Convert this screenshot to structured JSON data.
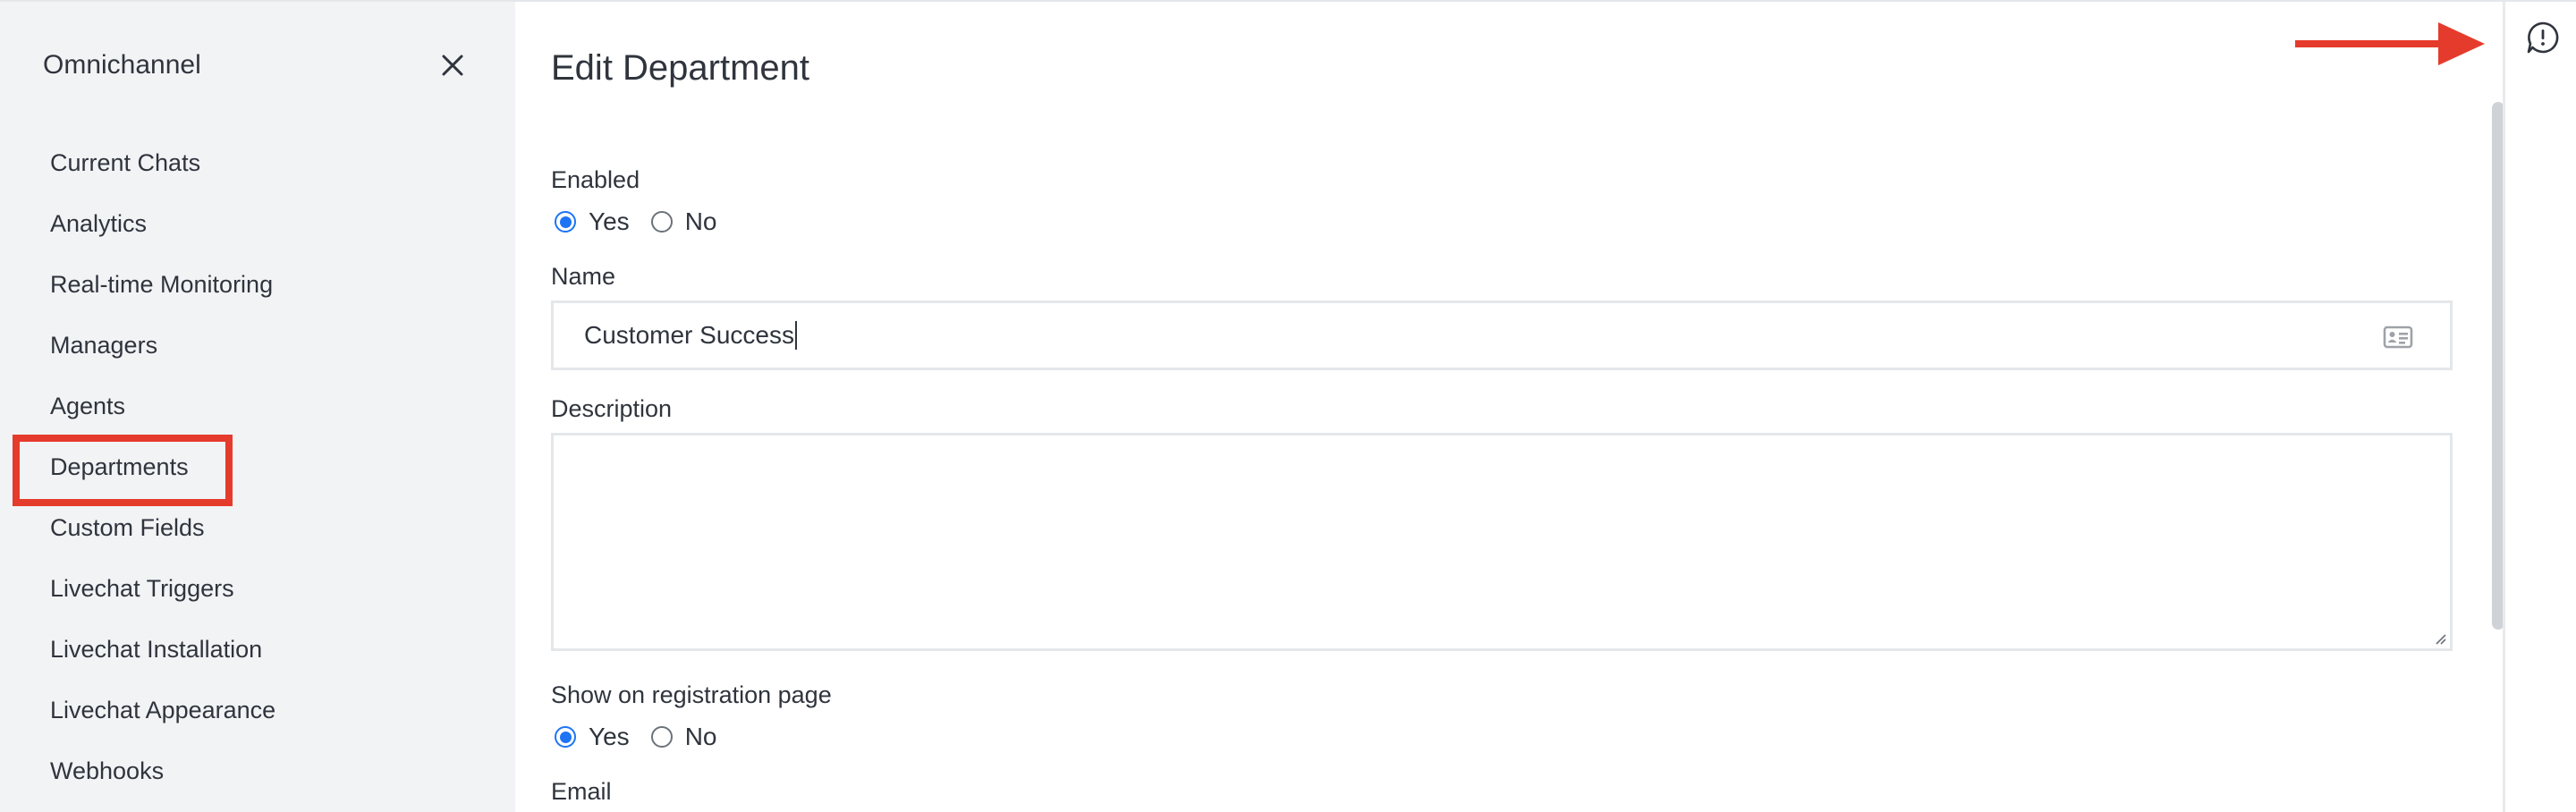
{
  "sidebar": {
    "title": "Omnichannel",
    "items": [
      {
        "label": "Current Chats"
      },
      {
        "label": "Analytics"
      },
      {
        "label": "Real-time Monitoring"
      },
      {
        "label": "Managers"
      },
      {
        "label": "Agents"
      },
      {
        "label": "Departments",
        "active": true
      },
      {
        "label": "Custom Fields"
      },
      {
        "label": "Livechat Triggers"
      },
      {
        "label": "Livechat Installation"
      },
      {
        "label": "Livechat Appearance"
      },
      {
        "label": "Webhooks"
      }
    ]
  },
  "main": {
    "title": "Edit Department",
    "enabled": {
      "label": "Enabled",
      "yes": "Yes",
      "no": "No",
      "selected": "Yes"
    },
    "name": {
      "label": "Name",
      "value": "Customer Success"
    },
    "description": {
      "label": "Description",
      "value": ""
    },
    "show_on_registration": {
      "label": "Show on registration page",
      "yes": "Yes",
      "no": "No",
      "selected": "Yes"
    },
    "email": {
      "label": "Email"
    }
  },
  "icons": {
    "close": "close-icon",
    "contact_card": "contact-card-icon",
    "alert": "alert-chat-icon"
  },
  "colors": {
    "accent": "#1d74f5",
    "annotation": "#e53b2c",
    "sidebar_bg": "#f2f3f5"
  }
}
